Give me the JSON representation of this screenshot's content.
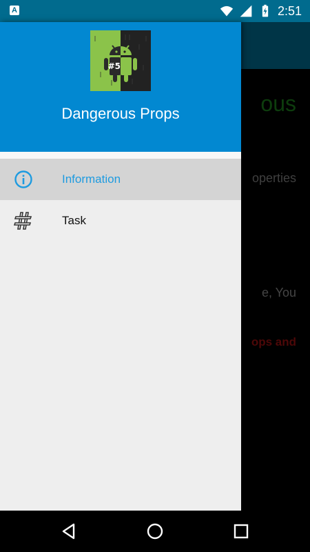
{
  "status_bar": {
    "notification_icon_letter": "A",
    "time": "2:51",
    "icons": [
      "wifi-icon",
      "signal-icon",
      "battery-charging-icon"
    ]
  },
  "background_screen": {
    "title_fragment": "ous",
    "line1_fragment": "operties",
    "line2_fragment": "e, You",
    "warning_fragment": "ops and"
  },
  "drawer": {
    "app_name": "Dangerous Props",
    "logo_badge": "#5",
    "items": [
      {
        "label": "Information",
        "icon": "info-icon",
        "selected": true
      },
      {
        "label": "Task",
        "icon": "hash-icon",
        "selected": false
      }
    ]
  },
  "nav_bar": {
    "buttons": [
      "back-icon",
      "home-icon",
      "recents-icon"
    ]
  },
  "colors": {
    "drawer_header": "#0288d1",
    "app_bar": "#016b8e",
    "selected_text": "#1e9be0",
    "bg_title": "#1b7a1b",
    "bg_warning": "#9b1010"
  }
}
